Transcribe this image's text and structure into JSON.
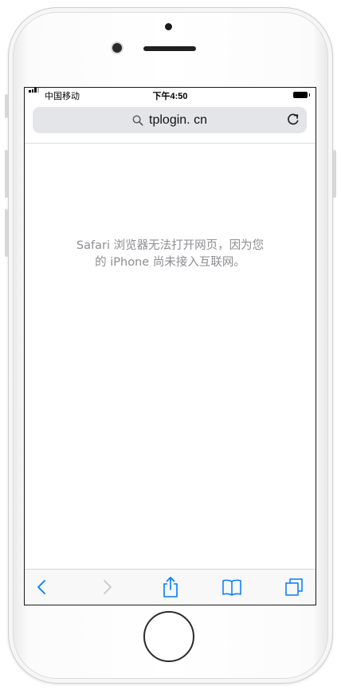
{
  "status_bar": {
    "carrier": "中国移动",
    "time": "下午4:50"
  },
  "address_bar": {
    "url": "tplogin. cn",
    "left_icon": "search-icon",
    "right_icon": "reload-icon"
  },
  "error": {
    "line1": "Safari 浏览器无法打开网页，因为您",
    "line2": "的 iPhone 尚未接入互联网。"
  },
  "toolbar": {
    "buttons": [
      "back-icon",
      "forward-icon",
      "share-icon",
      "bookmarks-icon",
      "tabs-icon"
    ],
    "accent": "#007aff",
    "disabled": "#c7c7cc"
  },
  "colors": {
    "message": "#8e8e93",
    "url_bar_bg": "#e4e5e8",
    "frame": "#f6f6f6"
  }
}
